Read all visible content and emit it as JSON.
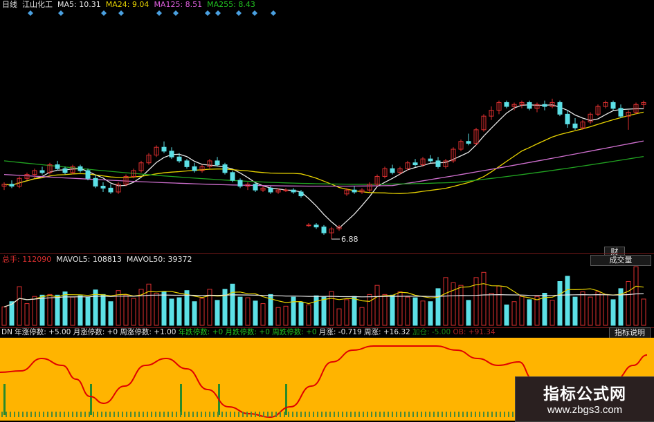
{
  "colors": {
    "up": "#e03030",
    "down": "#5ce0e6",
    "ma5": "#e8e8e8",
    "ma24": "#e8d300",
    "ma125": "#d070d0",
    "ma255": "#21a321",
    "oscillator_bg": "#ffb400",
    "oscillator_line": "#e00000",
    "oscillator_bars": "#2a8a2a"
  },
  "price_panel": {
    "period": "日线",
    "stock_name": "江山化工",
    "ma5": "MA5: 10.31",
    "ma24": "MA24: 9.04",
    "ma125": "MA125: 8.51",
    "ma255": "MA255: 8.43",
    "low_marker": "6.88"
  },
  "side_buttons": {
    "finance": "财",
    "volume": "成交量",
    "indicator_help": "指标说明"
  },
  "volume_panel": {
    "total": "总手: 112090",
    "mavol5": "MAVOL5: 108813",
    "mavol50": "MAVOL50: 39372"
  },
  "oscillator_panel": {
    "name": "DN",
    "year_limit_up": "年涨停数: +5.00",
    "month_limit_up": "月涨停数: +0",
    "week_limit_up": "周涨停数: +1.00",
    "year_limit_down": "年跌停数: +0",
    "month_limit_down": "月跌停数: +0",
    "week_limit_down": "周跌停数: +0",
    "month_change": "月涨: -0.719",
    "week_change": "周涨: +16.32",
    "extra_a": "加仓: -5.00",
    "extra_b": "OB: +91.34"
  },
  "watermark": {
    "title": "指标公式网",
    "url": "www.zbgs3.com"
  },
  "chart_data": {
    "type": "candlestick",
    "low_label": 6.88,
    "moving_averages": [
      "MA5",
      "MA24",
      "MA125",
      "MA255"
    ],
    "candles": [
      [
        9.6,
        9.8,
        9.4,
        9.7
      ],
      [
        9.7,
        9.9,
        9.5,
        9.6
      ],
      [
        9.6,
        10.1,
        9.5,
        10.0
      ],
      [
        10.0,
        10.3,
        9.9,
        10.2
      ],
      [
        10.2,
        10.5,
        10.0,
        10.4
      ],
      [
        10.4,
        10.6,
        10.2,
        10.3
      ],
      [
        10.3,
        10.8,
        10.2,
        10.7
      ],
      [
        10.7,
        10.9,
        10.4,
        10.5
      ],
      [
        10.5,
        10.6,
        10.2,
        10.3
      ],
      [
        10.3,
        10.7,
        10.2,
        10.6
      ],
      [
        10.6,
        10.7,
        10.3,
        10.4
      ],
      [
        10.4,
        10.5,
        9.9,
        10.0
      ],
      [
        10.0,
        10.2,
        9.5,
        9.6
      ],
      [
        9.6,
        9.8,
        9.3,
        9.5
      ],
      [
        9.5,
        9.7,
        9.2,
        9.3
      ],
      [
        9.3,
        9.8,
        9.2,
        9.7
      ],
      [
        9.7,
        10.2,
        9.6,
        10.1
      ],
      [
        10.1,
        10.5,
        10.0,
        10.4
      ],
      [
        10.4,
        10.9,
        10.3,
        10.8
      ],
      [
        10.8,
        11.3,
        10.7,
        11.2
      ],
      [
        11.2,
        11.7,
        11.1,
        11.6
      ],
      [
        11.6,
        11.9,
        11.3,
        11.4
      ],
      [
        11.4,
        11.6,
        11.0,
        11.1
      ],
      [
        11.1,
        11.3,
        10.8,
        10.9
      ],
      [
        10.9,
        11.0,
        10.5,
        10.6
      ],
      [
        10.6,
        10.8,
        10.3,
        10.4
      ],
      [
        10.4,
        10.7,
        10.3,
        10.6
      ],
      [
        10.6,
        11.0,
        10.5,
        10.9
      ],
      [
        10.9,
        11.1,
        10.6,
        10.7
      ],
      [
        10.7,
        10.8,
        10.2,
        10.3
      ],
      [
        10.3,
        10.4,
        9.8,
        9.9
      ],
      [
        9.9,
        10.0,
        9.5,
        9.6
      ],
      [
        9.6,
        9.8,
        9.4,
        9.7
      ],
      [
        9.7,
        9.8,
        9.3,
        9.4
      ],
      [
        9.4,
        9.6,
        9.3,
        9.5
      ],
      [
        9.5,
        9.6,
        9.2,
        9.3
      ],
      [
        9.3,
        9.5,
        9.2,
        9.4
      ],
      [
        9.4,
        9.5,
        9.3,
        9.4
      ],
      [
        9.4,
        9.5,
        9.2,
        9.3
      ],
      [
        9.3,
        9.4,
        9.0,
        9.1
      ],
      [
        7.6,
        7.7,
        7.5,
        7.6
      ],
      [
        7.6,
        7.7,
        7.4,
        7.5
      ],
      [
        7.5,
        7.6,
        7.1,
        7.2
      ],
      [
        7.2,
        7.5,
        6.88,
        7.4
      ],
      [
        7.4,
        7.6,
        7.3,
        7.5
      ],
      [
        9.2,
        9.5,
        9.1,
        9.4
      ],
      [
        9.4,
        9.6,
        9.2,
        9.3
      ],
      [
        9.3,
        9.5,
        9.2,
        9.4
      ],
      [
        9.4,
        9.8,
        9.3,
        9.7
      ],
      [
        9.7,
        10.2,
        9.6,
        10.1
      ],
      [
        10.1,
        10.6,
        10.0,
        10.5
      ],
      [
        10.5,
        10.7,
        10.2,
        10.3
      ],
      [
        10.3,
        10.6,
        10.2,
        10.5
      ],
      [
        10.5,
        10.9,
        10.4,
        10.8
      ],
      [
        10.8,
        11.0,
        10.6,
        10.7
      ],
      [
        10.7,
        11.1,
        10.6,
        11.0
      ],
      [
        11.0,
        11.2,
        10.8,
        10.9
      ],
      [
        10.9,
        11.1,
        10.5,
        10.6
      ],
      [
        10.6,
        11.0,
        10.5,
        10.9
      ],
      [
        10.9,
        11.6,
        10.8,
        11.5
      ],
      [
        11.5,
        12.0,
        11.4,
        11.9
      ],
      [
        11.9,
        12.3,
        11.7,
        11.8
      ],
      [
        11.8,
        12.6,
        11.7,
        12.5
      ],
      [
        12.5,
        13.3,
        12.4,
        13.2
      ],
      [
        13.2,
        13.7,
        13.0,
        13.5
      ],
      [
        13.5,
        14.0,
        13.3,
        13.9
      ],
      [
        13.9,
        14.0,
        13.6,
        13.7
      ],
      [
        13.7,
        13.9,
        13.5,
        13.8
      ],
      [
        13.8,
        14.0,
        13.6,
        13.9
      ],
      [
        13.9,
        14.0,
        13.5,
        13.6
      ],
      [
        13.6,
        13.9,
        13.4,
        13.8
      ],
      [
        13.8,
        14.0,
        13.5,
        13.7
      ],
      [
        13.7,
        14.1,
        13.6,
        13.9
      ],
      [
        13.9,
        14.0,
        13.2,
        13.3
      ],
      [
        13.3,
        13.5,
        12.6,
        12.8
      ],
      [
        12.8,
        13.1,
        12.5,
        12.6
      ],
      [
        12.6,
        13.0,
        12.5,
        12.9
      ],
      [
        12.9,
        13.4,
        12.8,
        13.3
      ],
      [
        13.3,
        13.8,
        13.2,
        13.7
      ],
      [
        13.7,
        14.0,
        13.6,
        13.9
      ],
      [
        13.9,
        14.0,
        13.5,
        13.6
      ],
      [
        13.6,
        13.8,
        13.1,
        13.2
      ],
      [
        13.2,
        13.5,
        12.5,
        13.4
      ],
      [
        13.4,
        13.9,
        13.3,
        13.8
      ],
      [
        13.8,
        14.0,
        13.6,
        13.9
      ]
    ],
    "volume_scale_max": 140000
  }
}
